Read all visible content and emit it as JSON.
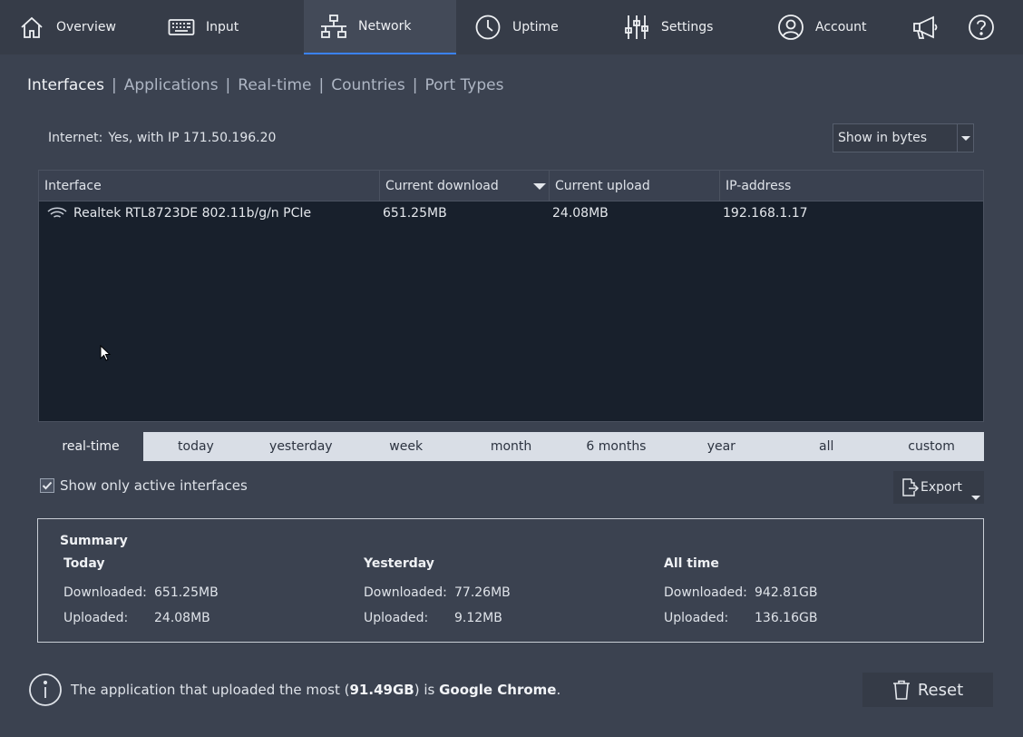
{
  "nav": {
    "overview": "Overview",
    "input": "Input",
    "network": "Network",
    "uptime": "Uptime",
    "settings": "Settings",
    "account": "Account"
  },
  "subnav": {
    "interfaces": "Interfaces",
    "applications": "Applications",
    "realtime": "Real-time",
    "countries": "Countries",
    "port_types": "Port Types",
    "separator": "|"
  },
  "internet": {
    "label": "Internet:",
    "value": "Yes, with IP 171.50.196.20"
  },
  "units_select": {
    "selected": "Show in bytes"
  },
  "table": {
    "columns": [
      "Interface",
      "Current download",
      "Current upload",
      "IP-address"
    ],
    "rows": [
      {
        "interface": "Realtek RTL8723DE 802.11b/g/n PCIe",
        "download": "651.25MB",
        "upload": "24.08MB",
        "ip": "192.168.1.17"
      }
    ]
  },
  "ranges": [
    "real-time",
    "today",
    "yesterday",
    "week",
    "month",
    "6 months",
    "year",
    "all",
    "custom"
  ],
  "active_only": {
    "label": "Show only active interfaces",
    "checked": true
  },
  "export": {
    "label": "Export"
  },
  "summary": {
    "title": "Summary",
    "today": {
      "heading": "Today",
      "downloaded_label": "Downloaded:",
      "downloaded": "651.25MB",
      "uploaded_label": "Uploaded:",
      "uploaded": "24.08MB"
    },
    "yesterday": {
      "heading": "Yesterday",
      "downloaded_label": "Downloaded:",
      "downloaded": "77.26MB",
      "uploaded_label": "Uploaded:",
      "uploaded": "9.12MB"
    },
    "all_time": {
      "heading": "All time",
      "downloaded_label": "Downloaded:",
      "downloaded": "942.81GB",
      "uploaded_label": "Uploaded:",
      "uploaded": "136.16GB"
    }
  },
  "info": {
    "prefix": "The application that uploaded the most (",
    "amount": "91.49GB",
    "middle": ") is ",
    "app": "Google Chrome",
    "suffix": "."
  },
  "reset": {
    "label": "Reset"
  },
  "colors": {
    "accent": "#3b82f6",
    "background": "#3b4250",
    "table_bg": "#18202c"
  }
}
